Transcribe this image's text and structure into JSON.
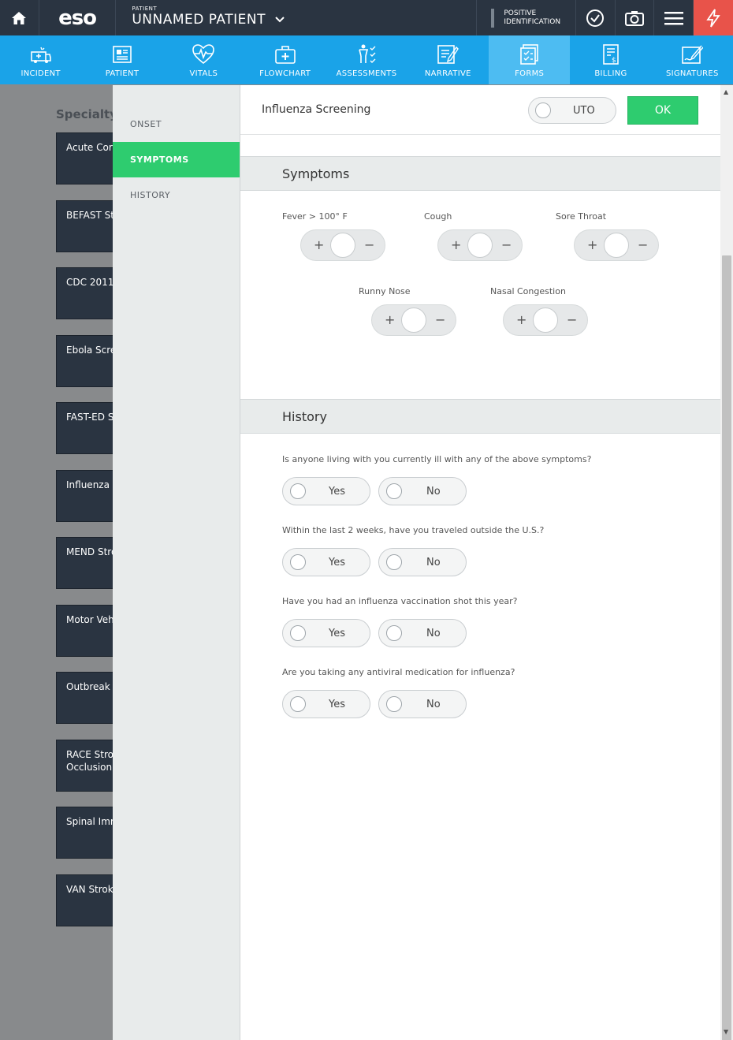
{
  "app": {
    "logo": "eso"
  },
  "patient": {
    "small_label": "PATIENT",
    "name": "UNNAMED PATIENT"
  },
  "positive_id": {
    "line1": "POSITIVE",
    "line2": "IDENTIFICATION"
  },
  "nav": [
    {
      "label": "INCIDENT",
      "icon": "ambulance-icon"
    },
    {
      "label": "PATIENT",
      "icon": "patient-card-icon"
    },
    {
      "label": "VITALS",
      "icon": "heartbeat-icon"
    },
    {
      "label": "FLOWCHART",
      "icon": "medkit-icon"
    },
    {
      "label": "ASSESSMENTS",
      "icon": "body-check-icon"
    },
    {
      "label": "NARRATIVE",
      "icon": "narrative-icon"
    },
    {
      "label": "FORMS",
      "icon": "forms-icon"
    },
    {
      "label": "BILLING",
      "icon": "billing-icon"
    },
    {
      "label": "SIGNATURES",
      "icon": "signature-icon"
    }
  ],
  "specialty": {
    "title": "Specialty F",
    "cards": [
      "Acute Core",
      "BEFAST St",
      "CDC 2011",
      "Ebola Scre",
      "FAST-ED S",
      "Influenza S",
      "MEND Stro",
      "Motor Veh",
      "Outbreak",
      "RACE Stro|Occlusion",
      "Spinal Imm",
      "VAN Strok"
    ]
  },
  "subnav": [
    "ONSET",
    "SYMPTOMS",
    "HISTORY"
  ],
  "form": {
    "title": "Influenza Screening",
    "uto_label": "UTO",
    "ok_label": "OK",
    "symptoms_header": "Symptoms",
    "symptoms": [
      "Fever > 100° F",
      "Cough",
      "Sore Throat",
      "Runny Nose",
      "Nasal Congestion"
    ],
    "history_header": "History",
    "questions": [
      "Is anyone living with you currently ill with any of the above symptoms?",
      "Within the last 2 weeks, have you traveled outside the U.S.?",
      "Have you had an influenza vaccination shot this year?",
      "Are you taking any antiviral medication for influenza?"
    ],
    "yes_label": "Yes",
    "no_label": "No"
  },
  "colors": {
    "nav": "#1aa3e8",
    "nav_active": "#4dbcf2",
    "green": "#2ecc6f",
    "topbar": "#2a3441",
    "alert": "#e8534a"
  }
}
